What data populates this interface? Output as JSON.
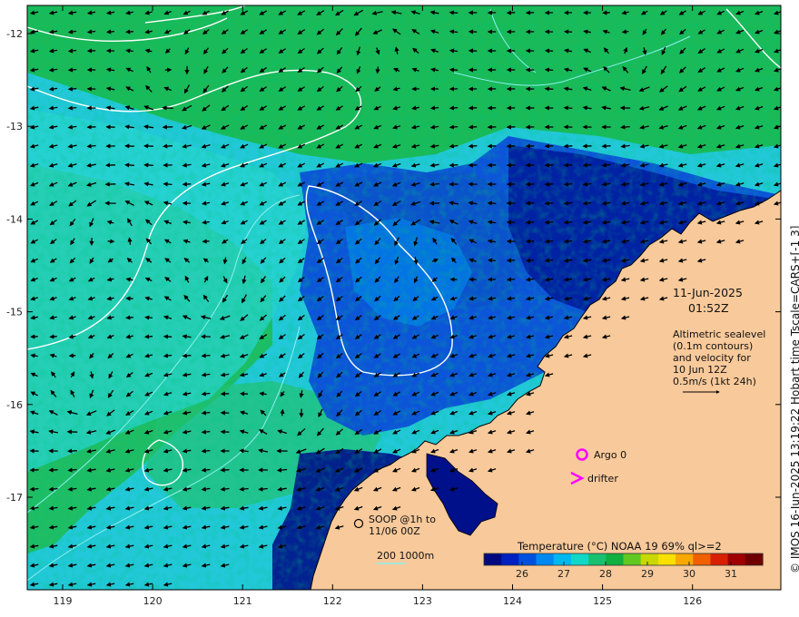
{
  "map": {
    "lon_ticks": [
      "119",
      "120",
      "121",
      "122",
      "123",
      "124",
      "125",
      "126"
    ],
    "lat_ticks": [
      "-12",
      "-13",
      "-14",
      "-15",
      "-16",
      "-17"
    ],
    "land_color": "#f8c99a",
    "ocean_palette": [
      "#000a8a",
      "#0030d0",
      "#0070f0",
      "#00b0f0",
      "#2ad6c8",
      "#18b848",
      "#00a030"
    ]
  },
  "annotations": {
    "date": "11-Jun-2025",
    "time": "01:52Z",
    "altimetry_lines": [
      "Altimetric sealevel",
      "(0.1m contours)",
      "and velocity for",
      "10 Jun 12Z",
      "0.5m/s (1kt 24h)"
    ],
    "argo_label": "Argo 0",
    "drifter_label": "drifter",
    "soop_lines": [
      "SOOP @1h to",
      "11/06 00Z"
    ],
    "depth_label": "200  1000m"
  },
  "colorbar": {
    "title": "Temperature (°C) NOAA 19 69% ql>=2",
    "tick_labels": [
      "26",
      "27",
      "28",
      "29",
      "30",
      "31"
    ],
    "colors": [
      "#000a80",
      "#0020c0",
      "#0050e0",
      "#0088f0",
      "#00b8f0",
      "#10d8c8",
      "#18c070",
      "#10b040",
      "#60c820",
      "#c8d800",
      "#f8e000",
      "#f8a800",
      "#f06000",
      "#d82000",
      "#a00000",
      "#700000"
    ]
  },
  "credit": "© IMOS 16-Jun-2025 13:19:22 Hobart time Tscale=CARS+[-1 3]"
}
